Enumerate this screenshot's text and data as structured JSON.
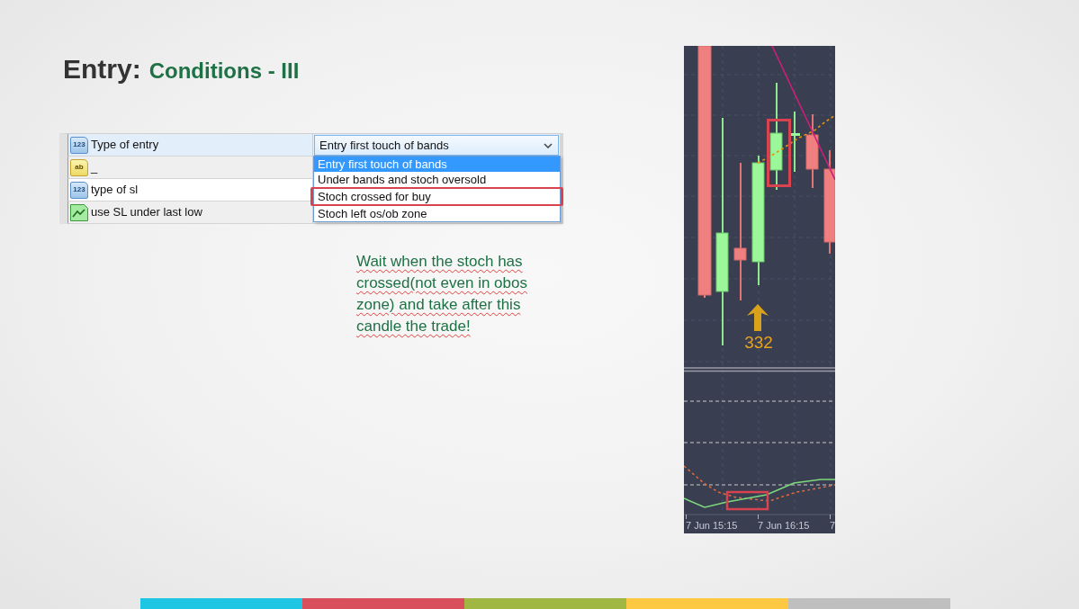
{
  "title": {
    "prefix": "Entry:",
    "text": "Conditions - III"
  },
  "settings_grid": {
    "rows": [
      {
        "kind": "number",
        "badge": "123",
        "name": "Type of entry",
        "selected": true,
        "dropdown": {
          "value": "Entry first touch of bands",
          "expanded": true,
          "options": [
            {
              "label": "Entry first touch of bands",
              "selected": true,
              "framed": false
            },
            {
              "label": "Under bands and stoch oversold",
              "selected": false,
              "framed": false
            },
            {
              "label": "Stoch crossed for buy",
              "selected": false,
              "framed": true
            },
            {
              "label": "Stoch left os/ob zone",
              "selected": false,
              "framed": false
            }
          ]
        }
      },
      {
        "kind": "text",
        "badge": "ab",
        "name": "_",
        "selected": false
      },
      {
        "kind": "number",
        "badge": "123",
        "name": "type of sl",
        "selected": false
      },
      {
        "kind": "graph",
        "name": "use SL under last low",
        "selected": false
      }
    ]
  },
  "note": {
    "text": "Wait when the stoch has crossed(not even in obos zone) and take after this candle the trade!",
    "spell_flagged": true
  },
  "chart": {
    "signal_label": "332",
    "time_labels": [
      "7 Jun 15:15",
      "7 Jun 16:15",
      "7"
    ]
  },
  "footer_stripes": [
    {
      "color": "#1fc6e3"
    },
    {
      "color": "#d94f5b"
    },
    {
      "color": "#a0b843"
    },
    {
      "color": "#fdc842"
    },
    {
      "color": "#bfbfbf"
    }
  ]
}
